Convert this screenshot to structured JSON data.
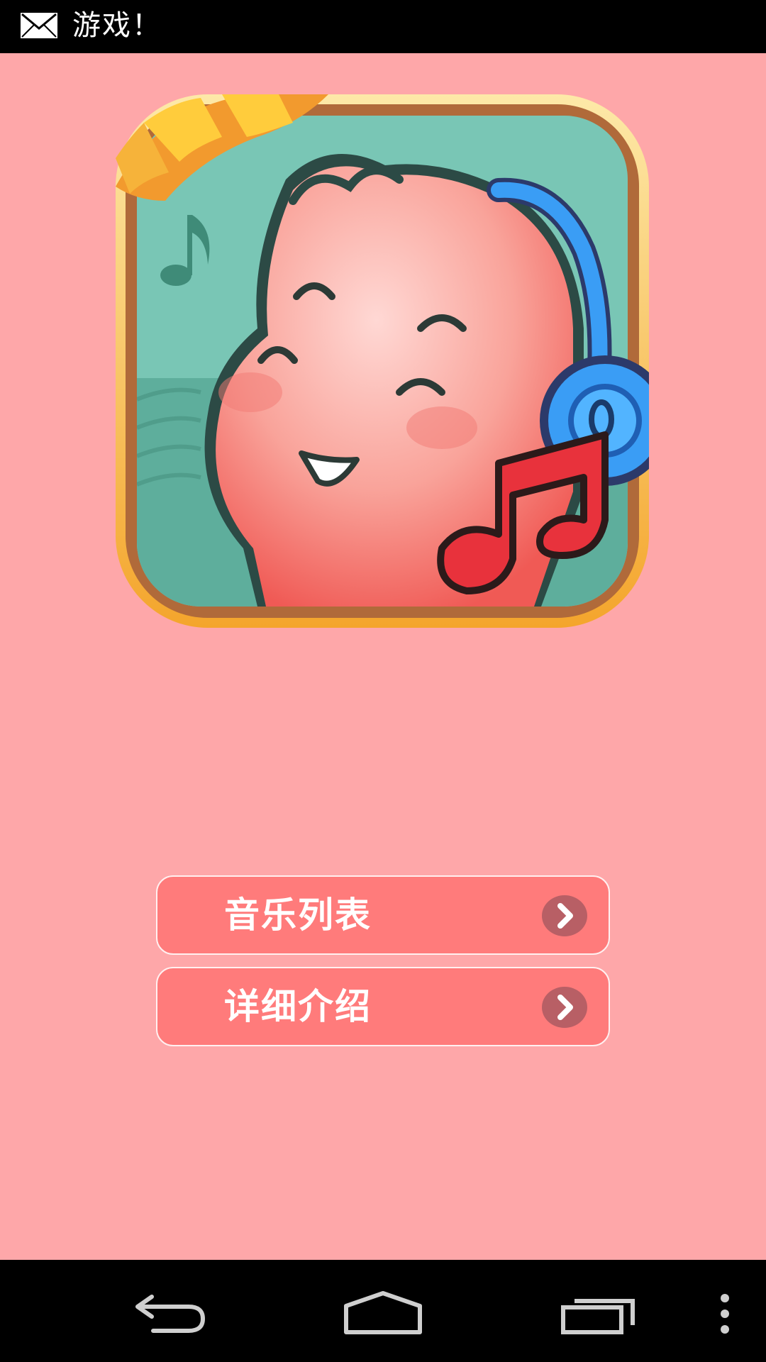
{
  "status_bar": {
    "notification_icon": "mail-icon",
    "title": "游戏！"
  },
  "logo": {
    "icon": "app-logo-cartoon-with-headphones"
  },
  "menu": {
    "items": [
      {
        "label": "音乐列表",
        "icon": "chevron-right-icon"
      },
      {
        "label": "详细介绍",
        "icon": "chevron-right-icon"
      }
    ]
  },
  "nav_bar": {
    "back_icon": "back-icon",
    "home_icon": "home-icon",
    "recents_icon": "recent-apps-icon",
    "menu_icon": "overflow-menu-icon"
  },
  "colors": {
    "background": "#fea7a9",
    "button": "#ff7b7b",
    "button_border": "#fff0f0",
    "arrow_circle": "#b85f65",
    "system_bar": "#000000"
  }
}
